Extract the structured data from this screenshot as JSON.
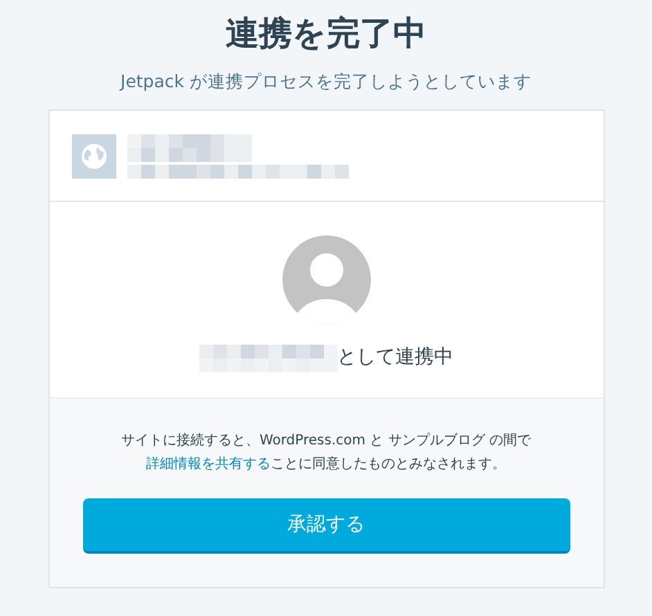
{
  "header": {
    "title": "連携を完了中",
    "subtitle": "Jetpack が連携プロセスを完了しようとしています"
  },
  "user": {
    "connecting_label": "として連携中"
  },
  "terms": {
    "before": "サイトに接続すると、WordPress.com と サンプルブログ の間で",
    "link": "詳細情報を共有する",
    "after": "ことに同意したものとみなされます。"
  },
  "approve_button": {
    "label": "承認する"
  }
}
